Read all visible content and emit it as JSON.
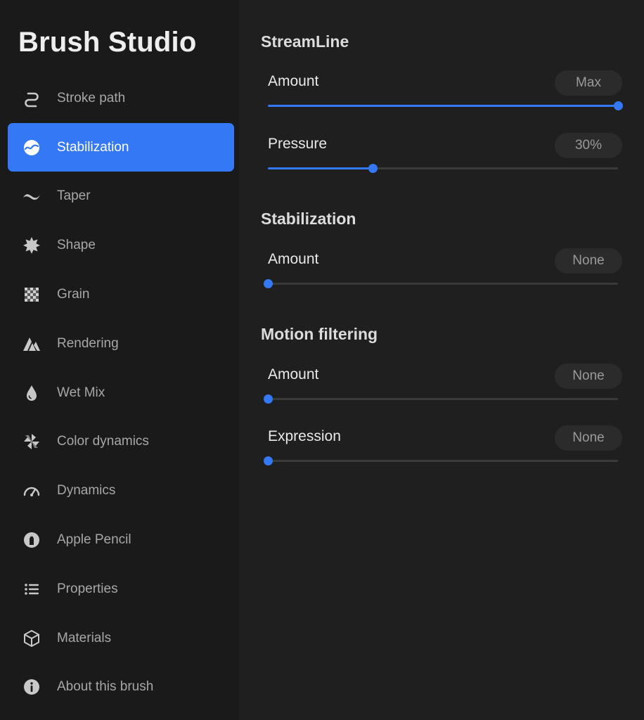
{
  "sidebar": {
    "title": "Brush Studio",
    "items": [
      {
        "label": "Stroke path",
        "icon": "stroke-path-icon"
      },
      {
        "label": "Stabilization",
        "icon": "stabilization-icon",
        "active": true
      },
      {
        "label": "Taper",
        "icon": "taper-icon"
      },
      {
        "label": "Shape",
        "icon": "shape-icon"
      },
      {
        "label": "Grain",
        "icon": "grain-icon"
      },
      {
        "label": "Rendering",
        "icon": "rendering-icon"
      },
      {
        "label": "Wet Mix",
        "icon": "wet-mix-icon"
      },
      {
        "label": "Color dynamics",
        "icon": "color-dynamics-icon"
      },
      {
        "label": "Dynamics",
        "icon": "dynamics-icon"
      },
      {
        "label": "Apple Pencil",
        "icon": "apple-pencil-icon"
      },
      {
        "label": "Properties",
        "icon": "properties-icon"
      },
      {
        "label": "Materials",
        "icon": "materials-icon"
      },
      {
        "label": "About this brush",
        "icon": "about-icon"
      }
    ]
  },
  "main": {
    "sections": [
      {
        "title": "StreamLine",
        "rows": [
          {
            "label": "Amount",
            "value": "Max",
            "level": 1.0
          },
          {
            "label": "Pressure",
            "value": "30%",
            "level": 0.3
          }
        ]
      },
      {
        "title": "Stabilization",
        "rows": [
          {
            "label": "Amount",
            "value": "None",
            "level": 0.0
          }
        ]
      },
      {
        "title": "Motion filtering",
        "rows": [
          {
            "label": "Amount",
            "value": "None",
            "level": 0.0
          },
          {
            "label": "Expression",
            "value": "None",
            "level": 0.0
          }
        ]
      }
    ]
  },
  "colors": {
    "accent": "#3478f6",
    "sidebar_bg": "#1a1a1a",
    "main_bg": "#1f1f1f"
  }
}
